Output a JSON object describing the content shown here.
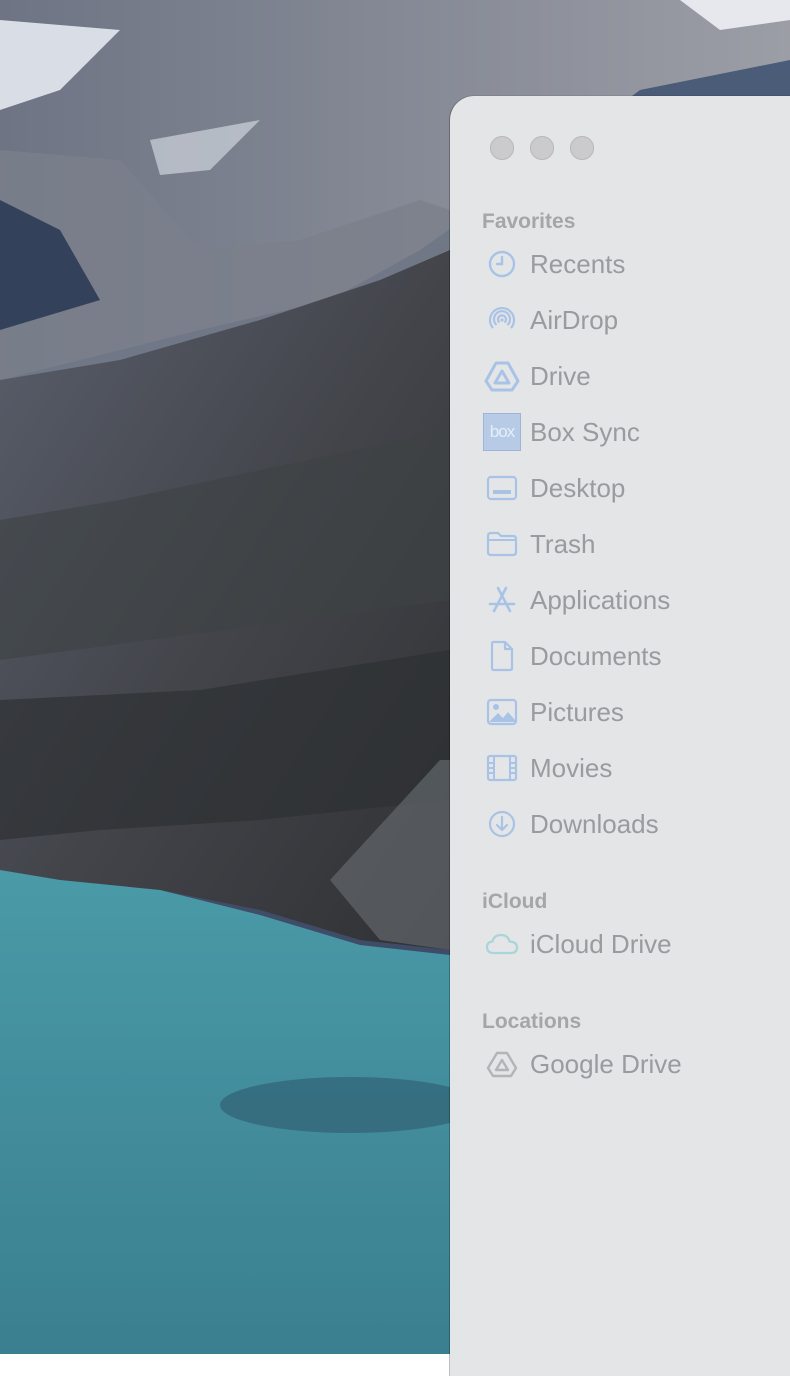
{
  "window": {
    "traffic_lights": [
      "close-button",
      "minimize-button",
      "zoom-button"
    ]
  },
  "sidebar": {
    "sections": [
      {
        "title": "Favorites",
        "items": [
          {
            "label": "Recents",
            "icon": "clock-icon"
          },
          {
            "label": "AirDrop",
            "icon": "airdrop-icon"
          },
          {
            "label": "Drive",
            "icon": "google-drive-icon"
          },
          {
            "label": "Box Sync",
            "icon": "box-logo-icon",
            "icon_text": "box"
          },
          {
            "label": "Desktop",
            "icon": "desktop-icon"
          },
          {
            "label": "Trash",
            "icon": "folder-icon"
          },
          {
            "label": "Applications",
            "icon": "applications-icon"
          },
          {
            "label": "Documents",
            "icon": "document-icon"
          },
          {
            "label": "Pictures",
            "icon": "pictures-icon"
          },
          {
            "label": "Movies",
            "icon": "film-icon"
          },
          {
            "label": "Downloads",
            "icon": "download-icon"
          }
        ]
      },
      {
        "title": "iCloud",
        "items": [
          {
            "label": "iCloud Drive",
            "icon": "cloud-icon"
          }
        ]
      },
      {
        "title": "Locations",
        "items": [
          {
            "label": "Google Drive",
            "icon": "google-drive-location-icon"
          }
        ]
      }
    ]
  },
  "colors": {
    "window_bg": "#e4e5e7",
    "section_title": "#a5a6a8",
    "item_label": "#9a9b9e",
    "icon_accent": "#a9c3e6",
    "lake": "#3f8b9b"
  }
}
